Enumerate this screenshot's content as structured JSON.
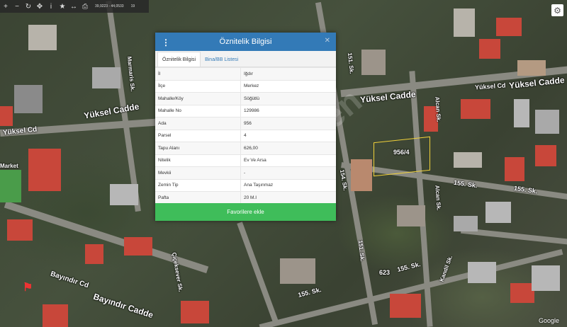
{
  "toolbar": {
    "coordinates": "39,9223 - 44,0533",
    "zoom": "19"
  },
  "map_labels": {
    "yuksel_cd_top_right": "Yüksel Cd",
    "yuksel_cadde_right": "Yüksel Cadde",
    "yuksel_cadde_mid": "Yüksel Cadde",
    "yuksel_cadde_left": "Yüksel Cadde",
    "yuksel_cd_left": "Yüksel Cd",
    "st_151": "151. Sk.",
    "st_154": "154. Sk.",
    "st_155": "155. Sk.",
    "st_155b": "155. Sk.",
    "st_155c": "155. Sk.",
    "st_155d": "155. Sk.",
    "st_623": "623",
    "st_151b": "151. Sk.",
    "alcan_sk": "Alcan Sk.",
    "alcan_sk2": "Alcan Sk.",
    "marmaris_sk": "Marmaris Sk.",
    "market": "Market",
    "ciceksever": "Çiçeksever Sk.",
    "bayindir_cd": "Bayındır Cd",
    "bayindir_cadde": "Bayındır Cadde",
    "parcel_label": "956/4",
    "google": "Google",
    "kandil": "Kandil Sk."
  },
  "modal": {
    "title": "Öznitelik Bilgisi",
    "tabs": [
      "Öznitelik Bilgisi",
      "Bina/BB Listesi"
    ],
    "rows": [
      {
        "key": "İl",
        "value": "Iğdır"
      },
      {
        "key": "İlçe",
        "value": "Merkez"
      },
      {
        "key": "Mahalle/Köy",
        "value": "Söğütlü"
      },
      {
        "key": "Mahalle No",
        "value": "129986"
      },
      {
        "key": "Ada",
        "value": "956"
      },
      {
        "key": "Parsel",
        "value": "4"
      },
      {
        "key": "Tapu Alanı",
        "value": "626,00"
      },
      {
        "key": "Nitelik",
        "value": "Ev Ve Arsa"
      },
      {
        "key": "Mevkii",
        "value": "-"
      },
      {
        "key": "Zemin Tip",
        "value": "Ana Taşınmaz"
      },
      {
        "key": "Pafta",
        "value": "20 M.I"
      }
    ],
    "favorite_label": "Favorilere ekle"
  },
  "colors": {
    "header": "#337ab7",
    "favorite": "#3fbd5a"
  }
}
